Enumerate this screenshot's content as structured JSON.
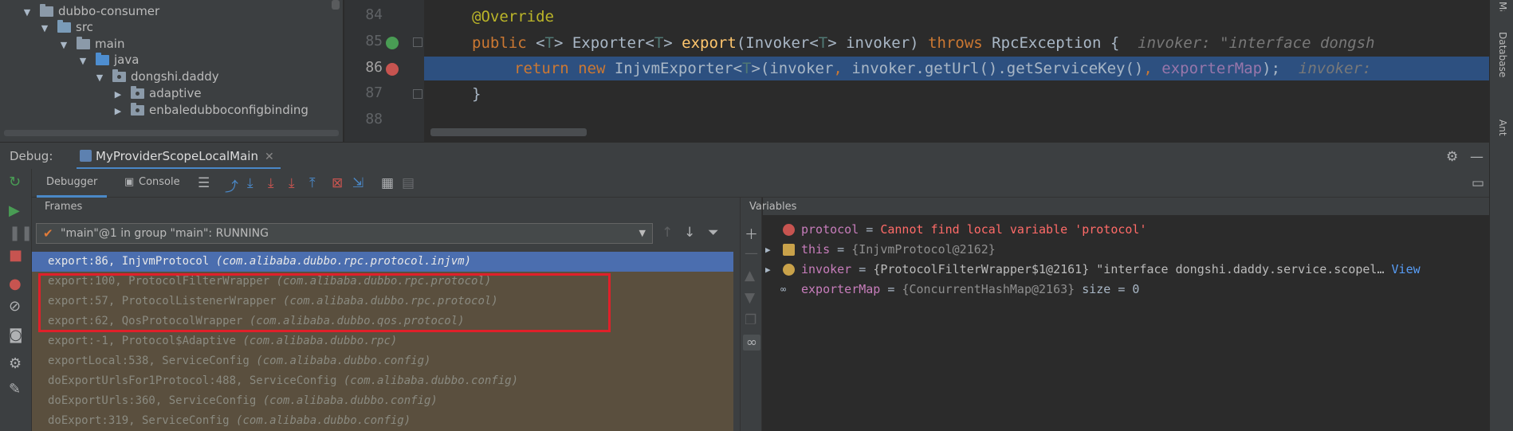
{
  "project_tree": {
    "items": [
      {
        "label": "dubbo-consumer",
        "expanded": true,
        "icon": "module-folder-icon"
      },
      {
        "label": "src",
        "expanded": true,
        "icon": "folder-icon"
      },
      {
        "label": "main",
        "expanded": true,
        "icon": "folder-icon"
      },
      {
        "label": "java",
        "expanded": true,
        "icon": "source-root-folder-icon"
      },
      {
        "label": "dongshi.daddy",
        "expanded": true,
        "icon": "package-icon"
      },
      {
        "label": "adaptive",
        "expanded": false,
        "icon": "package-icon"
      },
      {
        "label": "enbaledubboconfigbinding",
        "expanded": false,
        "icon": "package-icon"
      }
    ]
  },
  "editor": {
    "line_numbers": [
      "84",
      "85",
      "86",
      "87",
      "88"
    ],
    "lines": {
      "l84": "@Override",
      "l85_kw_public": "public",
      "l85_lt": " <",
      "l85_t1": "T",
      "l85_gt": "> Exporter<",
      "l85_t2": "T",
      "l85_fn_pre": "> ",
      "l85_fn": "export",
      "l85_args": "(Invoker<",
      "l85_t3": "T",
      "l85_args2": "> invoker) ",
      "l85_throws": "throws",
      "l85_exc": " RpcException {",
      "l85_hint": "invoker: \"interface dongsh",
      "l86_return": "return",
      "l86_new": "new",
      "l86_cls": " InjvmExporter<",
      "l86_t": "T",
      "l86_mid": ">(invoker",
      "l86_comma1": ",",
      "l86_call": " invoker.getUrl().getServiceKey()",
      "l86_comma2": ",",
      "l86_field": "exporterMap",
      "l86_end": ");",
      "l86_hint": "invoker:",
      "l87": "}"
    }
  },
  "right_strip": {
    "labels": [
      "Maven",
      "Database",
      "Ant"
    ]
  },
  "debug": {
    "title": "Debug:",
    "session_tab": "MyProviderScopeLocalMain",
    "tabs": {
      "debugger": "Debugger",
      "console": "Console"
    },
    "frames": {
      "label": "Frames",
      "thread": "\"main\"@1 in group \"main\": RUNNING",
      "rows": [
        {
          "method": "export:86, InjvmProtocol ",
          "pkg": "(com.alibaba.dubbo.rpc.protocol.injvm)",
          "selected": true
        },
        {
          "method": "export:100, ProtocolFilterWrapper ",
          "pkg": "(com.alibaba.dubbo.rpc.protocol)",
          "selected": false
        },
        {
          "method": "export:57, ProtocolListenerWrapper ",
          "pkg": "(com.alibaba.dubbo.rpc.protocol)",
          "selected": false
        },
        {
          "method": "export:62, QosProtocolWrapper ",
          "pkg": "(com.alibaba.dubbo.qos.protocol)",
          "selected": false
        },
        {
          "method": "export:-1, Protocol$Adaptive ",
          "pkg": "(com.alibaba.dubbo.rpc)",
          "selected": false
        },
        {
          "method": "exportLocal:538, ServiceConfig ",
          "pkg": "(com.alibaba.dubbo.config)",
          "selected": false
        },
        {
          "method": "doExportUrlsFor1Protocol:488, ServiceConfig ",
          "pkg": "(com.alibaba.dubbo.config)",
          "selected": false
        },
        {
          "method": "doExportUrls:360, ServiceConfig ",
          "pkg": "(com.alibaba.dubbo.config)",
          "selected": false
        },
        {
          "method": "doExport:319, ServiceConfig ",
          "pkg": "(com.alibaba.dubbo.config)",
          "selected": false
        }
      ]
    },
    "variables": {
      "label": "Variables",
      "rows": [
        {
          "name": "protocol",
          "eq": " = ",
          "value": "Cannot find local variable 'protocol'",
          "kind": "error"
        },
        {
          "name": "this",
          "eq": " = ",
          "value": "{InjvmProtocol@2162}",
          "kind": "object"
        },
        {
          "name": "invoker",
          "eq": " = ",
          "value": "{ProtocolFilterWrapper$1@2161} \"interface dongshi.daddy.service.scopel…",
          "link": "View",
          "kind": "param"
        },
        {
          "name": "exporterMap",
          "eq": " = ",
          "value": "{ConcurrentHashMap@2163}",
          "extra": "  size = 0",
          "kind": "watch"
        }
      ]
    }
  },
  "colors": {
    "accent": "#4a88c7",
    "execution_line": "#2d5080",
    "selected_frame": "#4b6eaf",
    "highlight_box": "#e0202a",
    "error_text": "#ff6b68"
  }
}
